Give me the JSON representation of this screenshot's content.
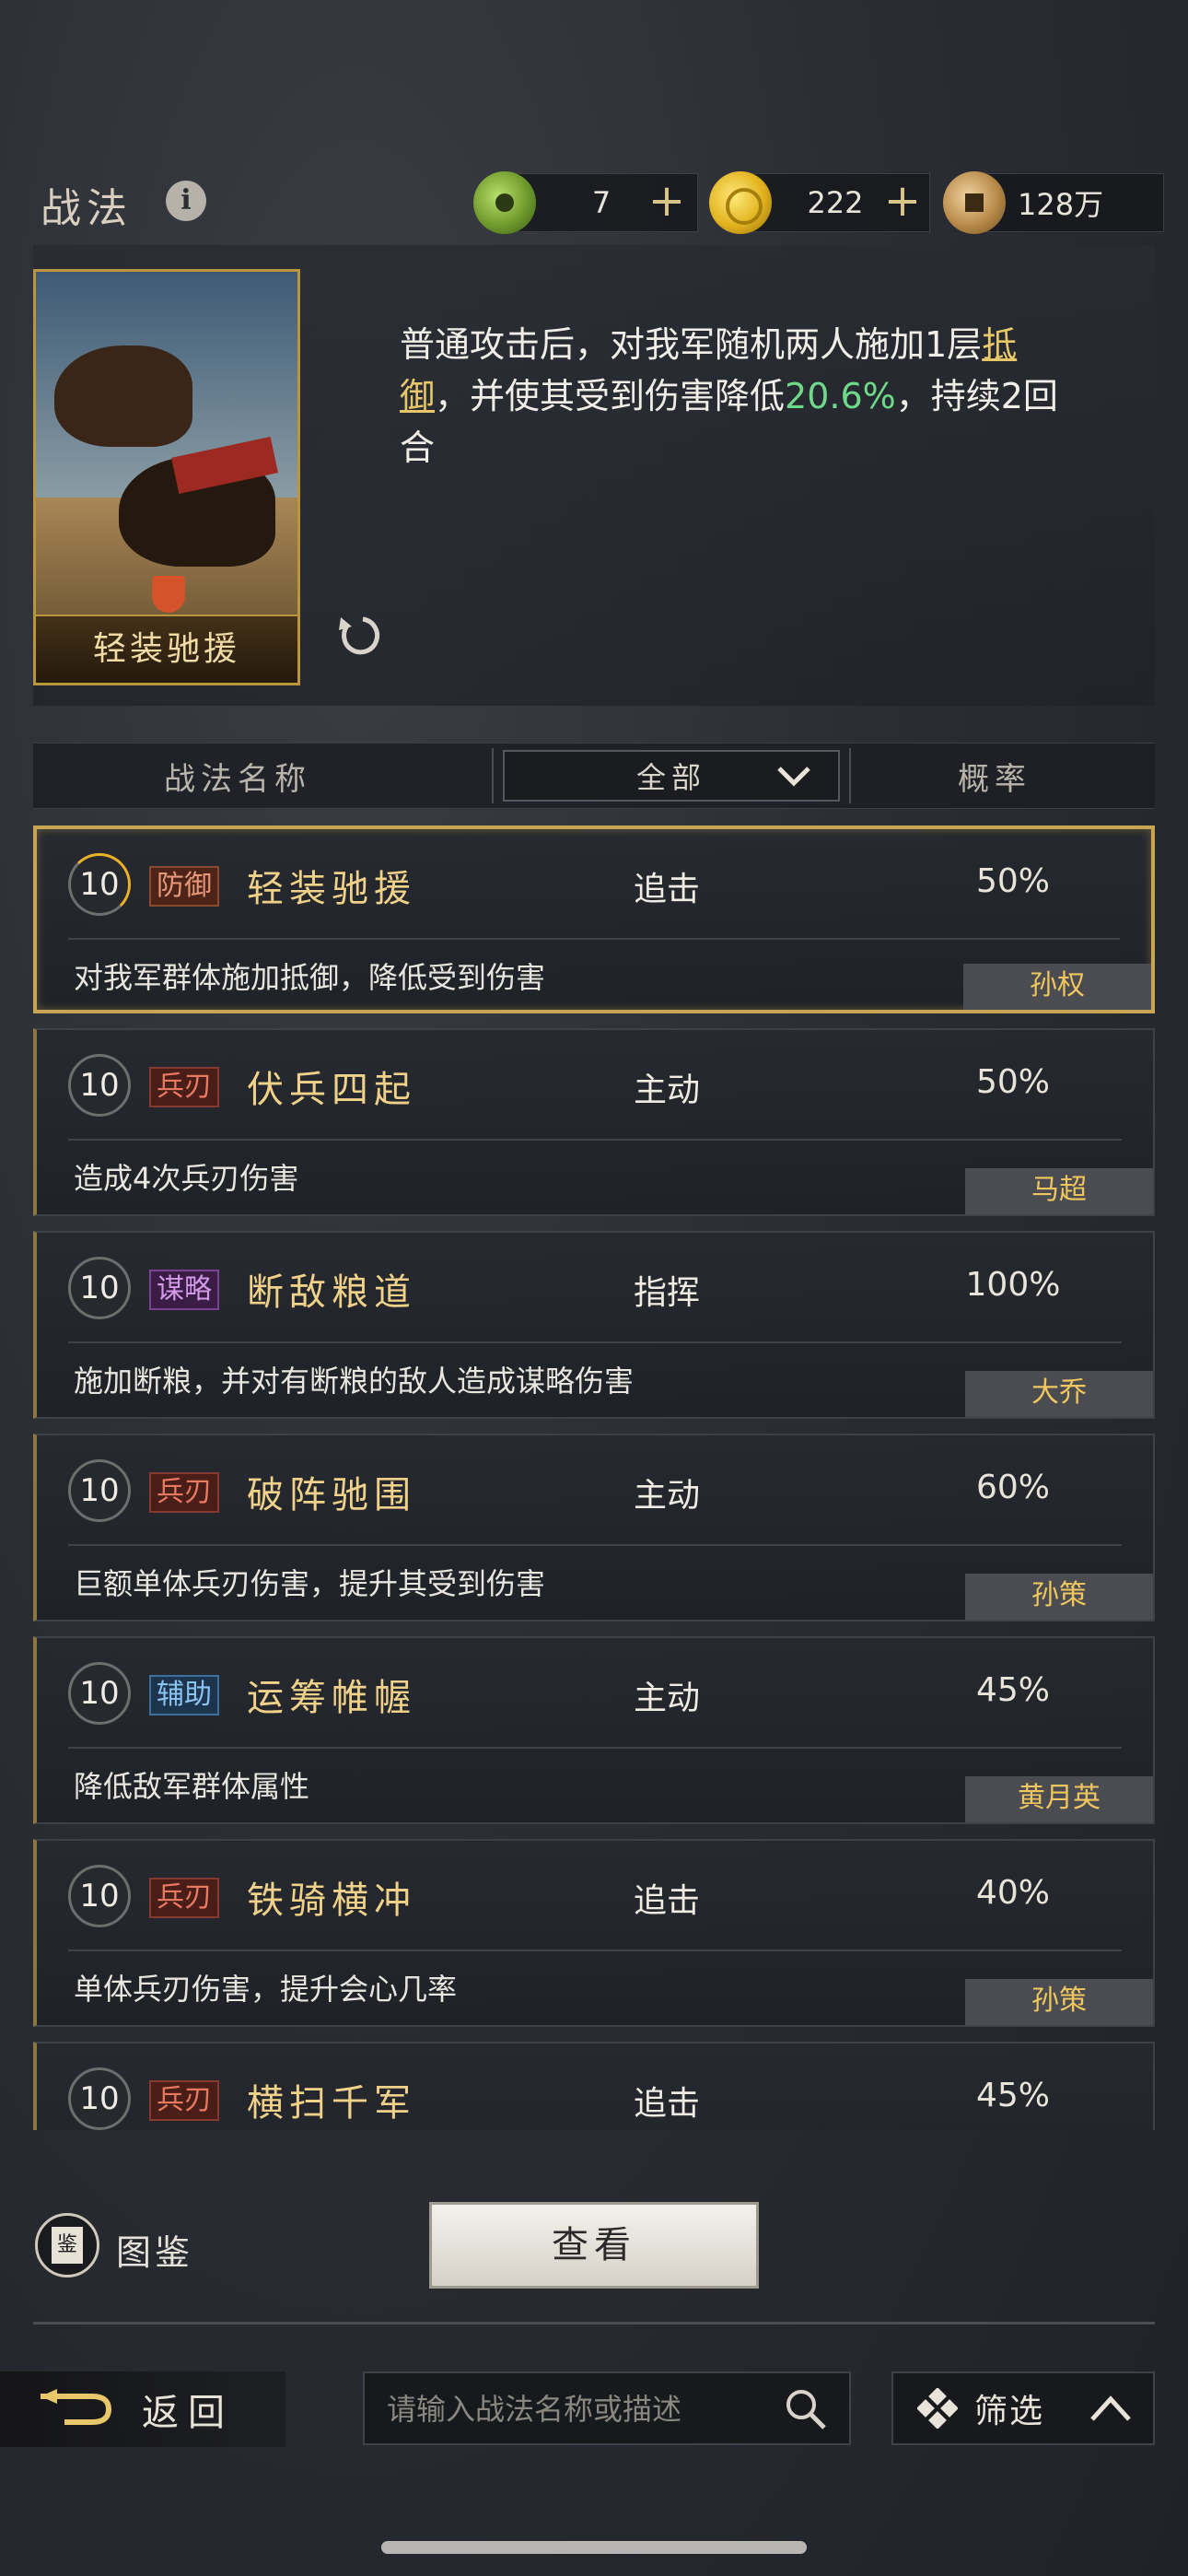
{
  "header": {
    "title": "战法",
    "info_icon": "info-icon",
    "currencies": [
      {
        "icon": "jade-coin-icon",
        "value": "7",
        "has_plus": true
      },
      {
        "icon": "gold-coin-icon",
        "value": "222",
        "has_plus": true
      },
      {
        "icon": "copper-coin-icon",
        "value": "128万",
        "has_plus": false
      }
    ]
  },
  "featured": {
    "card_name": "轻装驰援",
    "desc_part1": "普通攻击后，对我军随机两人施加1层",
    "desc_keyword": "抵御",
    "desc_part2": "，并使其受到伤害降低",
    "desc_value": "20.6%",
    "desc_part3": "，持续2回合"
  },
  "table_header": {
    "name_col": "战法名称",
    "filter_value": "全部",
    "rate_col": "概率"
  },
  "skills": [
    {
      "level": "10",
      "tag": "防御",
      "tag_color": "brown",
      "name": "轻装驰援",
      "type": "追击",
      "rate": "50%",
      "desc": "对我军群体施加抵御，降低受到伤害",
      "owner": "孙权",
      "selected": true
    },
    {
      "level": "10",
      "tag": "兵刃",
      "tag_color": "red",
      "name": "伏兵四起",
      "type": "主动",
      "rate": "50%",
      "desc": "造成4次兵刃伤害",
      "owner": "马超"
    },
    {
      "level": "10",
      "tag": "谋略",
      "tag_color": "purple",
      "name": "断敌粮道",
      "type": "指挥",
      "rate": "100%",
      "desc": "施加断粮，并对有断粮的敌人造成谋略伤害",
      "owner": "大乔"
    },
    {
      "level": "10",
      "tag": "兵刃",
      "tag_color": "red",
      "name": "破阵驰围",
      "type": "主动",
      "rate": "60%",
      "desc": "巨额单体兵刃伤害，提升其受到伤害",
      "owner": "孙策"
    },
    {
      "level": "10",
      "tag": "辅助",
      "tag_color": "blue",
      "name": "运筹帷幄",
      "type": "主动",
      "rate": "45%",
      "desc": "降低敌军群体属性",
      "owner": "黄月英"
    },
    {
      "level": "10",
      "tag": "兵刃",
      "tag_color": "red",
      "name": "铁骑横冲",
      "type": "追击",
      "rate": "40%",
      "desc": "单体兵刃伤害，提升会心几率",
      "owner": "孙策"
    },
    {
      "level": "10",
      "tag": "兵刃",
      "tag_color": "red",
      "name": "横扫千军",
      "type": "追击",
      "rate": "45%",
      "desc": "",
      "owner": ""
    }
  ],
  "bottom": {
    "atlas_label": "图鉴",
    "atlas_glyph": "鉴",
    "view_button": "查看",
    "back_label": "返回",
    "search_placeholder": "请输入战法名称或描述",
    "filter_label": "筛选"
  },
  "colors": {
    "gold_accent": "#c7a552",
    "highlight_green": "#6fd98a",
    "owner_text": "#f0c75e"
  }
}
